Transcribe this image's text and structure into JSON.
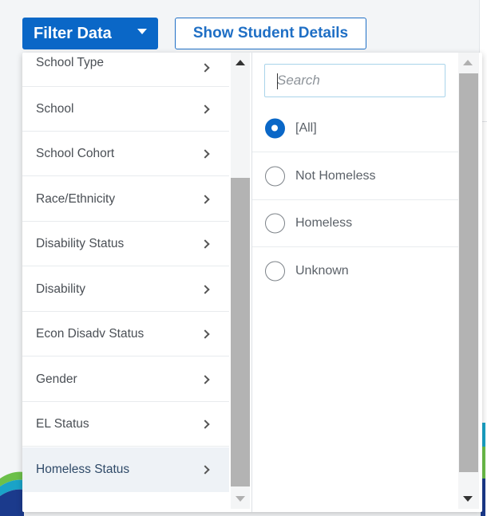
{
  "toolbar": {
    "filter_label": "Filter Data",
    "details_label": "Show Student Details"
  },
  "categories": [
    {
      "label": "School Type"
    },
    {
      "label": "School"
    },
    {
      "label": "School Cohort"
    },
    {
      "label": "Race/Ethnicity"
    },
    {
      "label": "Disability Status"
    },
    {
      "label": "Disability"
    },
    {
      "label": "Econ Disadv Status"
    },
    {
      "label": "Gender"
    },
    {
      "label": "EL Status"
    },
    {
      "label": "Homeless Status"
    }
  ],
  "active_category": "Homeless Status",
  "search": {
    "placeholder": "Search"
  },
  "options": [
    {
      "label": "[All]",
      "selected": true
    },
    {
      "label": "Not Homeless",
      "selected": false
    },
    {
      "label": "Homeless",
      "selected": false
    },
    {
      "label": "Unknown",
      "selected": false
    }
  ],
  "colors": {
    "accent": "#0a67c7",
    "active_row": "#eef2f6",
    "scroll_thumb": "#b3b3b3"
  }
}
